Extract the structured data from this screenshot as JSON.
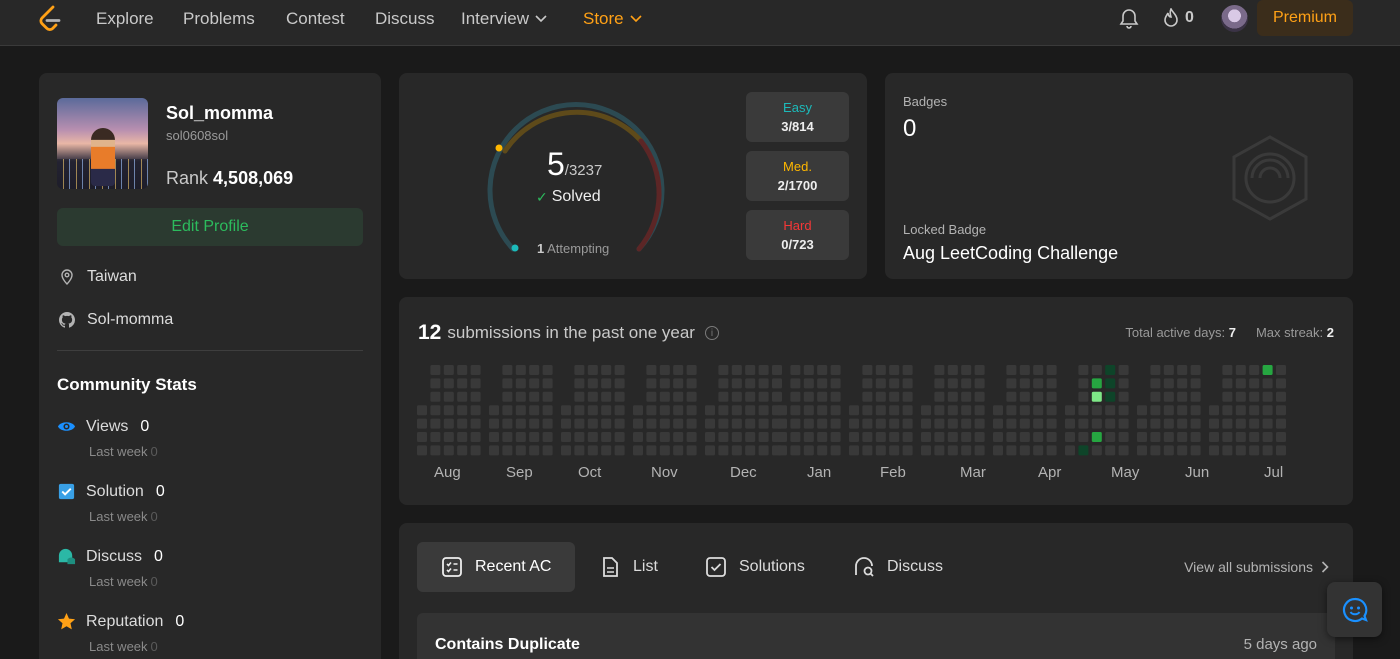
{
  "nav": {
    "items": [
      "Explore",
      "Problems",
      "Contest",
      "Discuss",
      "Interview"
    ],
    "store": "Store",
    "streak": "0",
    "premium": "Premium"
  },
  "profile": {
    "name": "Sol_momma",
    "id": "sol0608sol",
    "rank_label": "Rank",
    "rank_value": "4,508,069",
    "edit": "Edit Profile",
    "location": "Taiwan",
    "github": "Sol-momma"
  },
  "community": {
    "title": "Community Stats",
    "stats": [
      {
        "label": "Views",
        "value": "0",
        "sub_label": "Last week",
        "sub_value": "0",
        "icon": "eye-icon",
        "color": "#1a90ff"
      },
      {
        "label": "Solution",
        "value": "0",
        "sub_label": "Last week",
        "sub_value": "0",
        "icon": "checkbox-icon",
        "color": "#39a0e6"
      },
      {
        "label": "Discuss",
        "value": "0",
        "sub_label": "Last week",
        "sub_value": "0",
        "icon": "chat-bubbles-icon",
        "color": "#2bb8a6"
      },
      {
        "label": "Reputation",
        "value": "0",
        "sub_label": "Last week",
        "sub_value": "0",
        "icon": "star-icon",
        "color": "#ffa116"
      }
    ]
  },
  "solved": {
    "count": "5",
    "total": "/3237",
    "label": "Solved",
    "attempting_count": "1",
    "attempting_label": "Attempting",
    "difficulties": [
      {
        "label": "Easy",
        "value": "3/814",
        "color": "#1cbaba"
      },
      {
        "label": "Med.",
        "value": "2/1700",
        "color": "#ffb700"
      },
      {
        "label": "Hard",
        "value": "0/723",
        "color": "#f63737"
      }
    ]
  },
  "badges": {
    "label": "Badges",
    "count": "0",
    "locked_label": "Locked Badge",
    "locked_name": "Aug LeetCoding Challenge"
  },
  "submissions": {
    "count": "12",
    "title": "submissions in the past one year",
    "active_days_label": "Total active days:",
    "active_days": "7",
    "max_streak_label": "Max streak:",
    "max_streak": "2",
    "months": [
      "Aug",
      "Sep",
      "Oct",
      "Nov",
      "Dec",
      "Jan",
      "Feb",
      "Mar",
      "Apr",
      "May",
      "Jun",
      "Jul"
    ],
    "colors": {
      "empty": "#393939",
      "low": "#0e4429",
      "mid": "#26a641",
      "high": "#7ee787"
    }
  },
  "recent": {
    "tabs": [
      "Recent AC",
      "List",
      "Solutions",
      "Discuss"
    ],
    "view_all": "View all submissions",
    "items": [
      {
        "title": "Contains Duplicate",
        "time": "5 days ago"
      }
    ]
  }
}
